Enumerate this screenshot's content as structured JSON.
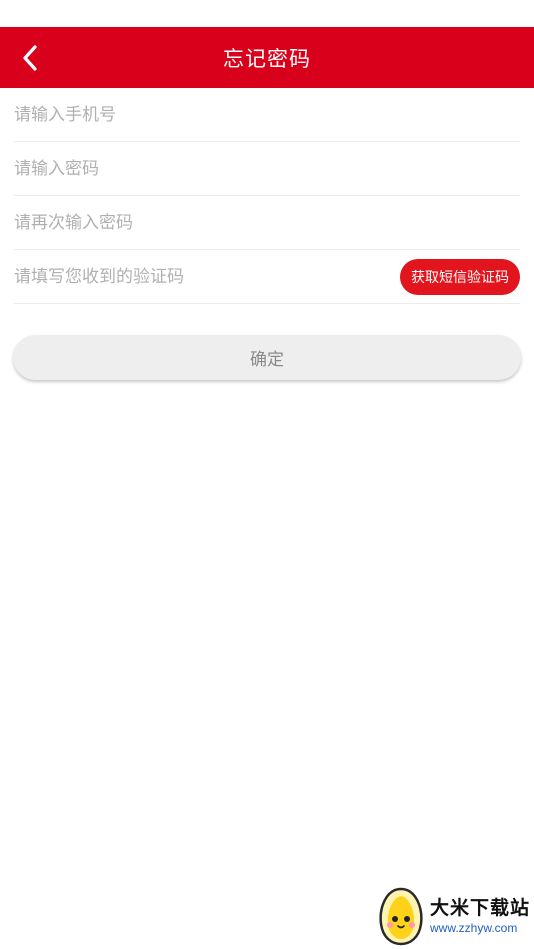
{
  "header": {
    "title": "忘记密码",
    "accent_color": "#d9001b",
    "back_icon": "chevron-left-icon"
  },
  "form": {
    "phone_placeholder": "请输入手机号",
    "password_placeholder": "请输入密码",
    "confirm_password_placeholder": "请再次输入密码",
    "code_placeholder": "请填写您收到的验证码",
    "sms_button_label": "获取短信验证码",
    "sms_button_color": "#e2141d"
  },
  "confirm_button": {
    "label": "确定"
  },
  "watermark": {
    "name": "大米下载站",
    "url": "www.zzhyw.com",
    "logo_icon": "rice-mascot-icon"
  }
}
